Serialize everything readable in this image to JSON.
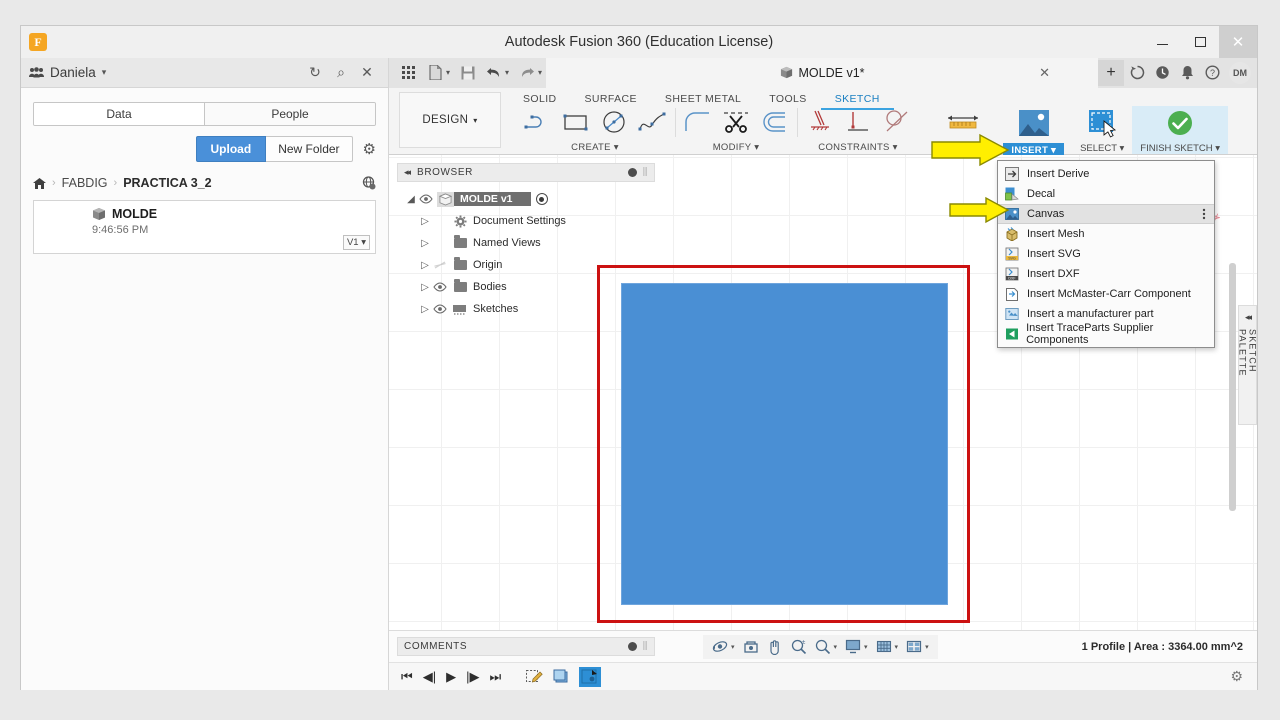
{
  "window": {
    "title": "Autodesk Fusion 360 (Education License)",
    "logo_letter": "F",
    "minimize": "–",
    "maximize": "□",
    "close": "×"
  },
  "data_panel": {
    "people_icon": "people-icon",
    "user": "Daniela",
    "caret": "▾",
    "refresh_icon": "↻",
    "search_icon": "⌕",
    "close_icon": "✕",
    "tabs": [
      {
        "label": "Data"
      },
      {
        "label": "People"
      }
    ],
    "upload_label": "Upload",
    "new_folder_label": "New Folder",
    "settings_icon": "⚙",
    "breadcrumb": {
      "home_icon": "⌂",
      "sep": "›",
      "items": [
        "FABDIG",
        "PRACTICA 3_2"
      ]
    },
    "globe_icon": "globe-icon",
    "file": {
      "name": "MOLDE",
      "time": "9:46:56 PM",
      "version": "V1 ▾"
    }
  },
  "quick_access": {
    "grid_icon": "▦",
    "file_icon": "🗎",
    "save_icon": "💾",
    "undo_icon": "↶",
    "redo_icon": "↷",
    "caret": "▾",
    "document_tab": "MOLDE v1*",
    "tab_close": "✕",
    "new_tab": "+",
    "sync_icon": "↻",
    "history_icon": "🕘",
    "notification_icon": "🔔",
    "help_icon": "?",
    "avatar_initials": "DM"
  },
  "ribbon": {
    "design_label": "DESIGN",
    "design_caret": "▾",
    "workspace_tabs": [
      {
        "label": "SOLID",
        "active": false
      },
      {
        "label": "SURFACE",
        "active": false
      },
      {
        "label": "SHEET METAL",
        "active": false
      },
      {
        "label": "TOOLS",
        "active": false
      },
      {
        "label": "SKETCH",
        "active": true
      }
    ],
    "groups": [
      {
        "label": "CREATE ▾",
        "name": "create-group"
      },
      {
        "label": "MODIFY ▾",
        "name": "modify-group"
      },
      {
        "label": "CONSTRAINTS ▾",
        "name": "constraints-group"
      }
    ],
    "buttons": [
      {
        "label": "INSPECT ▾",
        "name": "inspect-button"
      },
      {
        "label": "INSERT ▾",
        "name": "insert-button",
        "highlighted": true
      },
      {
        "label": "SELECT ▾",
        "name": "select-button"
      },
      {
        "label": "FINISH SKETCH ▾",
        "name": "finish-sketch-button"
      }
    ]
  },
  "browser": {
    "title": "BROWSER",
    "collapse_icon": "◂◂",
    "dot_icon": "⦁",
    "root": {
      "label": "MOLDE v1",
      "twist": "◢",
      "eye": "👁"
    },
    "nodes": [
      {
        "label": "Document Settings",
        "twist": "▷",
        "icon": "gear-icon",
        "eye": ""
      },
      {
        "label": "Named Views",
        "twist": "▷",
        "icon": "folder-icon",
        "eye": ""
      },
      {
        "label": "Origin",
        "twist": "▷",
        "icon": "folder-icon",
        "eye": "hidden"
      },
      {
        "label": "Bodies",
        "twist": "▷",
        "icon": "folder-icon",
        "eye": "visible"
      },
      {
        "label": "Sketches",
        "twist": "▷",
        "icon": "sketches-icon",
        "eye": "visible"
      }
    ]
  },
  "insert_menu": {
    "items": [
      {
        "label": "Insert Derive",
        "icon": "insert-derive-icon",
        "selected": false
      },
      {
        "label": "Decal",
        "icon": "decal-icon",
        "selected": false
      },
      {
        "label": "Canvas",
        "icon": "canvas-icon",
        "selected": true,
        "overflow": "⋮"
      },
      {
        "label": "Insert Mesh",
        "icon": "insert-mesh-icon",
        "selected": false
      },
      {
        "label": "Insert SVG",
        "icon": "insert-svg-icon",
        "selected": false
      },
      {
        "label": "Insert DXF",
        "icon": "insert-dxf-icon",
        "selected": false
      },
      {
        "label": "Insert McMaster-Carr Component",
        "icon": "mcmaster-icon",
        "selected": false
      },
      {
        "label": "Insert a manufacturer part",
        "icon": "manufacturer-part-icon",
        "selected": false
      },
      {
        "label": "Insert TraceParts Supplier Components",
        "icon": "traceparts-icon",
        "selected": false
      }
    ]
  },
  "sketch_palette": {
    "label": "SKETCH PALETTE",
    "collapse_icon": "◂◂"
  },
  "status_bar": {
    "comments_label": "COMMENTS",
    "comments_dot": "⦁",
    "info": "1 Profile | Area : 3364.00 mm^2",
    "nav_tools": [
      {
        "name": "orbit-icon"
      },
      {
        "name": "look-at-icon"
      },
      {
        "name": "pan-icon"
      },
      {
        "name": "zoom-icon"
      },
      {
        "name": "fit-icon"
      },
      {
        "name": "display-settings-icon"
      },
      {
        "name": "grid-settings-icon"
      },
      {
        "name": "viewports-icon"
      }
    ]
  },
  "timeline": {
    "controls": [
      "⏮",
      "◀|",
      "▶",
      "|▶",
      "⏭"
    ],
    "items": [
      {
        "name": "sketch-timeline-item"
      },
      {
        "name": "extrude-timeline-item"
      },
      {
        "name": "active-timeline-item",
        "active": true
      }
    ],
    "settings_icon": "⚙"
  },
  "canvas": {
    "profile_name": "blue-square-profile",
    "annotation_color": "#cc1111",
    "fill_color": "#4a8fd4"
  },
  "colors": {
    "accent_blue": "#2d8fd5",
    "upload_blue": "#4a90d9",
    "highlight_yellow": "#ffef00",
    "annotation_red": "#cc1111",
    "finish_green": "#4caf50"
  }
}
